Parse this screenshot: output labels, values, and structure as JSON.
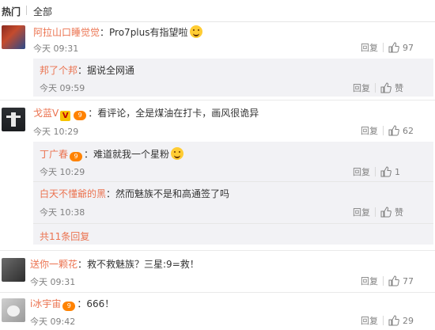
{
  "tabs": {
    "hot": "热门",
    "all": "全部"
  },
  "actions": {
    "reply": "回复",
    "like_word": "赞"
  },
  "comments": [
    {
      "user": "阿拉山口睡觉觉",
      "text": "：Pro7plus有指望啦",
      "time": "今天 09:31",
      "likes": "97",
      "replies": [
        {
          "user": "邦了个邦",
          "text": "：据说全网通",
          "time": "今天 09:59",
          "likes": "赞"
        }
      ]
    },
    {
      "user": "戈蓝V",
      "verified_badge": "V",
      "fan_badge": "9",
      "text": "：看评论，全是煤油在打卡，画风很诡异",
      "time": "今天 10:29",
      "likes": "62",
      "replies": [
        {
          "user": "丁广春",
          "fan_badge": "9",
          "text": "：难道就我一个星粉",
          "time": "今天 10:29",
          "likes": "1"
        },
        {
          "user": "白天不懂爺的黑",
          "text": "：然而魅族不是和高通签了吗",
          "time": "今天 10:38",
          "likes": "赞"
        }
      ],
      "expand": "共11条回复"
    },
    {
      "user": "送你一颗花",
      "text": "：救不救魅族？三星:9=救！",
      "time": "今天 09:31",
      "likes": "77"
    },
    {
      "user": "i冰宇宙",
      "fan_badge": "9",
      "text": "：666！",
      "time": "今天 09:42",
      "likes": "29"
    }
  ],
  "colors": {
    "username": "#eb7350",
    "meta": "#808080",
    "reply_bg": "#f2f2f5"
  },
  "icons": {
    "like": "thumbs-up-icon",
    "emoji": "grin-emoji-icon"
  }
}
